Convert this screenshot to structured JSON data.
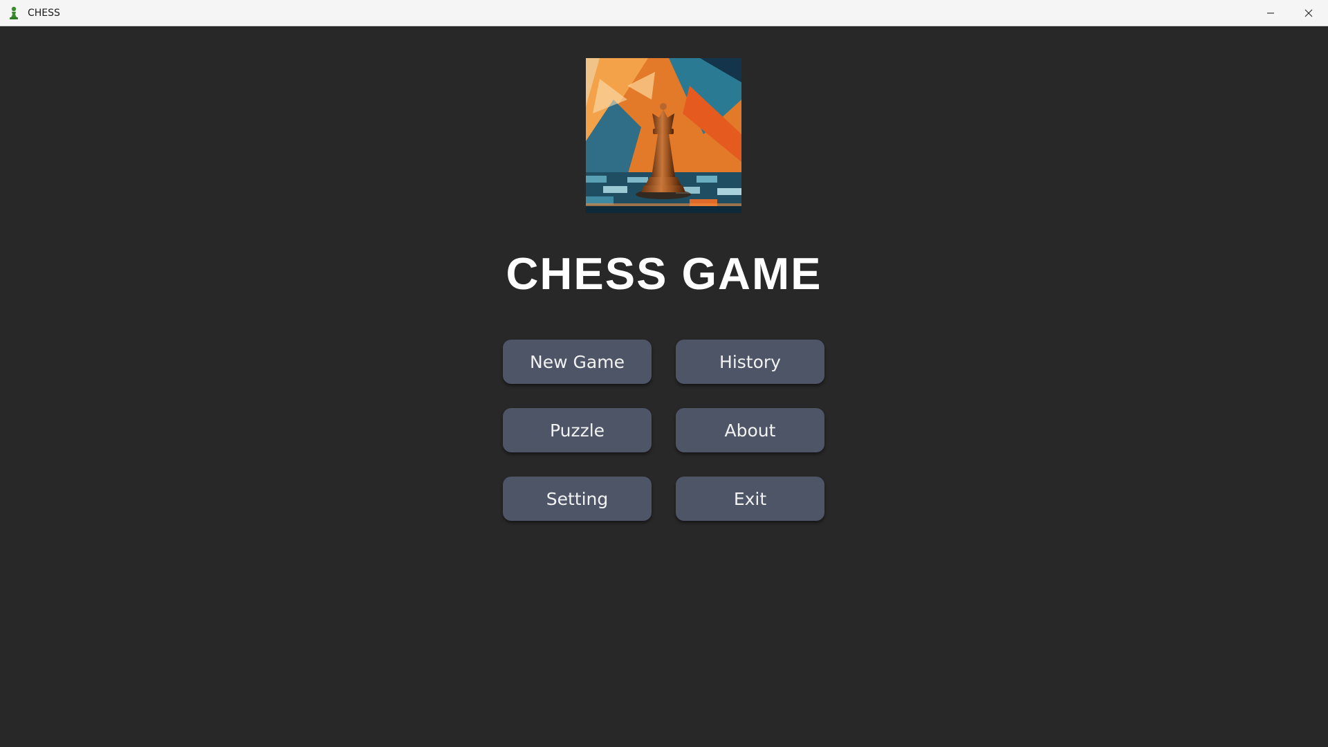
{
  "window": {
    "title": "CHESS",
    "icon": "green-pawn-icon",
    "controls": {
      "minimize_icon": "minimize-icon",
      "close_icon": "close-icon"
    }
  },
  "main": {
    "hero_image": "queen-chess-piece-artwork",
    "title": "CHESS GAME",
    "buttons": {
      "new_game": "New Game",
      "history": "History",
      "puzzle": "Puzzle",
      "about": "About",
      "setting": "Setting",
      "exit": "Exit"
    }
  },
  "colors": {
    "background": "#282828",
    "button": "#4d5566",
    "button_text": "#f2f2f2",
    "title_text": "#ffffff",
    "titlebar": "#f5f5f5"
  }
}
